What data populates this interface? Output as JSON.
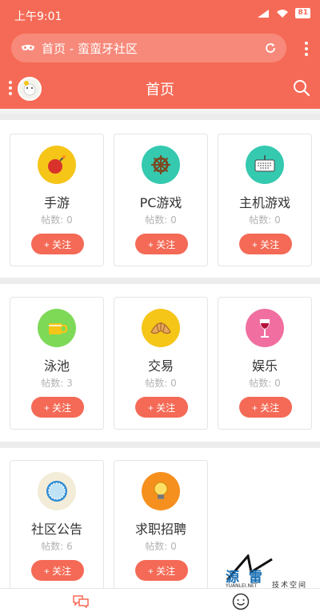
{
  "status": {
    "time": "上午9:01",
    "battery": "81"
  },
  "browser": {
    "url": "首页 - 蛮蛮牙社区"
  },
  "appbar": {
    "title": "首页"
  },
  "cards": [
    {
      "name": "手游",
      "count": "帖数: 0",
      "follow": "+ 关注",
      "color": "#f5c518",
      "icon": "bomb-icon"
    },
    {
      "name": "PC游戏",
      "count": "帖数: 0",
      "follow": "+ 关注",
      "color": "#35c9b0",
      "icon": "ship-wheel-icon"
    },
    {
      "name": "主机游戏",
      "count": "帖数: 0",
      "follow": "+ 关注",
      "color": "#35c9b0",
      "icon": "keyboard-icon"
    },
    {
      "name": "泳池",
      "count": "帖数: 3",
      "follow": "+ 关注",
      "color": "#7ed957",
      "icon": "mug-icon"
    },
    {
      "name": "交易",
      "count": "帖数: 0",
      "follow": "+ 关注",
      "color": "#f5c518",
      "icon": "croissant-icon"
    },
    {
      "name": "娱乐",
      "count": "帖数: 0",
      "follow": "+ 关注",
      "color": "#f06fa0",
      "icon": "wine-glass-icon"
    },
    {
      "name": "社区公告",
      "count": "帖数: 6",
      "follow": "+ 关注",
      "color": "#f2ecd8",
      "icon": "plate-icon"
    },
    {
      "name": "求职招聘",
      "count": "帖数: 0",
      "follow": "+ 关注",
      "color": "#f5901e",
      "icon": "lightbulb-icon"
    }
  ],
  "watermark": {
    "main": "源 雷",
    "site": "YUANLEI.NET",
    "sub": "技术空间"
  },
  "colors": {
    "accent": "#f56a56",
    "button": "#f46a56"
  }
}
